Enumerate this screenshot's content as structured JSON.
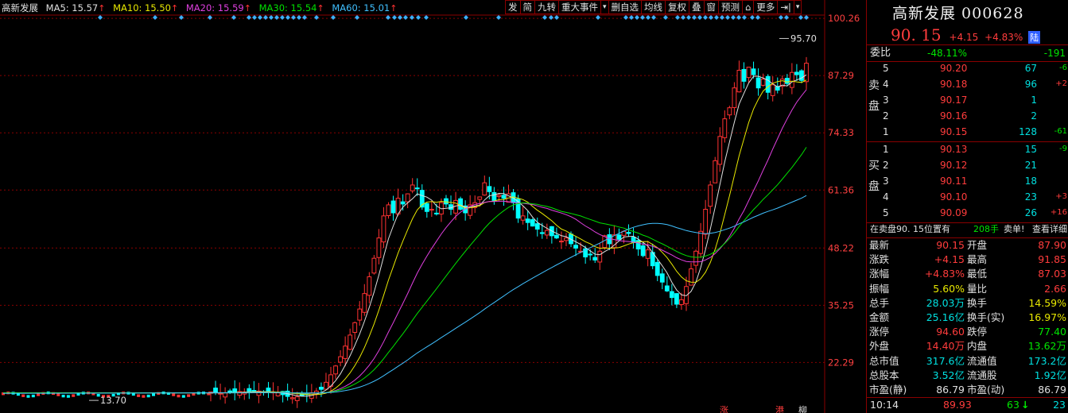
{
  "ma_bar": {
    "name": "高新发展",
    "items": [
      {
        "label": "MA5: 15.57",
        "color": "#e0e0e0"
      },
      {
        "label": "MA10: 15.50",
        "color": "#e8e800"
      },
      {
        "label": "MA20: 15.59",
        "color": "#e040e0"
      },
      {
        "label": "MA30: 15.54",
        "color": "#00e000"
      },
      {
        "label": "MA60: 15.01",
        "color": "#40c0ff"
      }
    ]
  },
  "toolbar": [
    "发",
    "简",
    "九转",
    "重大事件",
    "▾",
    "删自选",
    "均线",
    "复权",
    "叠",
    "窗",
    "预测",
    "⌂",
    "更多",
    "⇥|",
    "▾"
  ],
  "y_axis": [
    "100.26",
    "87.29",
    "74.33",
    "61.36",
    "48.22",
    "35.25",
    "22.29"
  ],
  "chart_labels": {
    "high": "95.70",
    "low": "13.70"
  },
  "bottom_markers": [
    "涨",
    "港",
    "柳"
  ],
  "colors": {
    "up": "#ff3232",
    "down": "#00ffff",
    "axis": "#8a0000",
    "ma5": "#e0e0e0",
    "ma10": "#e8e800",
    "ma20": "#e040e0",
    "ma30": "#00e000",
    "ma60": "#40c0ff"
  },
  "chart_data": {
    "type": "candlestick",
    "ylim": [
      13.0,
      101.0
    ],
    "y_ticks": [
      100.26,
      87.29,
      74.33,
      61.36,
      48.22,
      35.25,
      22.29
    ],
    "high_marker": 95.7,
    "low_marker": 13.7,
    "closes": [
      15.6,
      15.5,
      15.3,
      15.4,
      15.6,
      15.5,
      15.7,
      15.6,
      15.6,
      15.7,
      15.8,
      15.6,
      15.5,
      15.6,
      15.4,
      15.0,
      14.6,
      14.3,
      14.5,
      14.8,
      15.0,
      15.4,
      15.8,
      16.2,
      17.8,
      19.5,
      21.5,
      23.6,
      26.0,
      28.5,
      31.3,
      34.4,
      37.9,
      41.7,
      45.9,
      50.5,
      55.5,
      58.0,
      56.2,
      59.5,
      58.2,
      60.5,
      62.5,
      61.8,
      57.5,
      56.5,
      57.0,
      56.0,
      58.5,
      58.2,
      57.0,
      59.0,
      57.0,
      56.2,
      58.0,
      58.5,
      59.8,
      63.0,
      61.0,
      59.0,
      60.2,
      59.5,
      60.5,
      58.5,
      55.0,
      55.5,
      54.0,
      53.2,
      52.5,
      51.5,
      52.2,
      51.0,
      50.5,
      49.8,
      50.5,
      49.2,
      48.2,
      47.5,
      46.2,
      46.8,
      45.5,
      47.5,
      51.0,
      49.2,
      51.2,
      50.2,
      52.0,
      51.5,
      49.5,
      48.0,
      46.5,
      47.8,
      44.2,
      42.0,
      40.5,
      38.5,
      37.0,
      35.5,
      36.5,
      39.5,
      43.5,
      47.5,
      52.0,
      57.0,
      62.5,
      68.0,
      73.5,
      77.5,
      80.0,
      84.5,
      88.5,
      86.0,
      89.2,
      87.5,
      84.5,
      86.5,
      83.5,
      85.2,
      84.0,
      86.5,
      85.5,
      88.0,
      87.5,
      86.2,
      90.1
    ]
  },
  "panel": {
    "title": "高新发展 000628",
    "price": "90. 15",
    "change": "+4.15",
    "change_pct": "+4.83%",
    "market": "陆",
    "weibi": {
      "label": "委比",
      "pct": "-48.11%",
      "val": "-191"
    },
    "sell_label": "卖盘",
    "buy_label": "买盘",
    "sell": [
      {
        "lvl": "5",
        "price": "90.20",
        "vol": "67",
        "chg": "-6"
      },
      {
        "lvl": "4",
        "price": "90.18",
        "vol": "96",
        "chg": "+2"
      },
      {
        "lvl": "3",
        "price": "90.17",
        "vol": "1",
        "chg": ""
      },
      {
        "lvl": "2",
        "price": "90.16",
        "vol": "2",
        "chg": ""
      },
      {
        "lvl": "1",
        "price": "90.15",
        "vol": "128",
        "chg": "-61"
      }
    ],
    "buy": [
      {
        "lvl": "1",
        "price": "90.13",
        "vol": "15",
        "chg": "-9"
      },
      {
        "lvl": "2",
        "price": "90.12",
        "vol": "21",
        "chg": ""
      },
      {
        "lvl": "3",
        "price": "90.11",
        "vol": "18",
        "chg": ""
      },
      {
        "lvl": "4",
        "price": "90.10",
        "vol": "23",
        "chg": "+3"
      },
      {
        "lvl": "5",
        "price": "90.09",
        "vol": "26",
        "chg": "+16"
      }
    ],
    "notice": {
      "text": "在卖盘90. 15位置有",
      "hands": "208手",
      "sell1": "卖单!",
      "detail": "查看详细"
    },
    "stats": [
      {
        "l1": "最新",
        "v1": "90.15",
        "c1": "red",
        "l2": "开盘",
        "v2": "87.90",
        "c2": "red"
      },
      {
        "l1": "涨跌",
        "v1": "+4.15",
        "c1": "red",
        "l2": "最高",
        "v2": "91.85",
        "c2": "red"
      },
      {
        "l1": "涨幅",
        "v1": "+4.83%",
        "c1": "red",
        "l2": "最低",
        "v2": "87.03",
        "c2": "red"
      },
      {
        "l1": "振幅",
        "v1": "5.60%",
        "c1": "yellow",
        "l2": "量比",
        "v2": "2.66",
        "c2": "red"
      },
      {
        "l1": "总手",
        "v1": "28.03万",
        "c1": "cyan",
        "l2": "换手",
        "v2": "14.59%",
        "c2": "yellow"
      },
      {
        "l1": "金额",
        "v1": "25.16亿",
        "c1": "cyan",
        "l2": "换手(实)",
        "v2": "16.97%",
        "c2": "yellow"
      },
      {
        "l1": "涨停",
        "v1": "94.60",
        "c1": "red",
        "l2": "跌停",
        "v2": "77.40",
        "c2": "green"
      },
      {
        "l1": "外盘",
        "v1": "14.40万",
        "c1": "red",
        "l2": "内盘",
        "v2": "13.62万",
        "c2": "green"
      },
      {
        "l1": "总市值",
        "v1": "317.6亿",
        "c1": "cyan",
        "l2": "流通值",
        "v2": "173.2亿",
        "c2": "cyan"
      },
      {
        "l1": "总股本",
        "v1": "3.52亿",
        "c1": "cyan",
        "l2": "流通股",
        "v2": "1.92亿",
        "c2": "cyan"
      },
      {
        "l1": "市盈(静)",
        "v1": "86.79",
        "c1": "white",
        "l2": "市盈(动)",
        "v2": "86.79",
        "c2": "white"
      }
    ],
    "tick": {
      "time": "10:14",
      "price": "89.93",
      "vol": "63",
      "arrow": "↓",
      "count": "23"
    }
  }
}
